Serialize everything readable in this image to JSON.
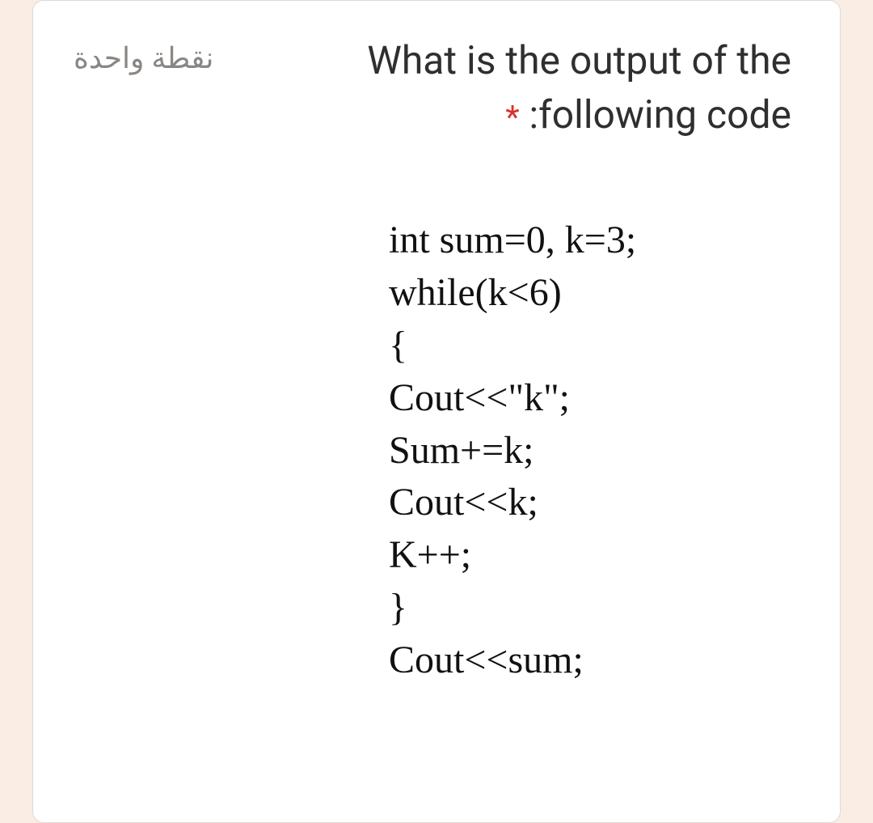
{
  "points_label": "نقطة واحدة",
  "question": {
    "line1": "What is the output of the",
    "asterisk": "*",
    "line2_prefix": " :following code"
  },
  "code": {
    "l1": "int sum=0, k=3;",
    "l2": "while(k<6)",
    "l3": "{",
    "l4": "Cout<<\"k\";",
    "l5": "Sum+=k;",
    "l6": "Cout<<k;",
    "l7": "K++;",
    "l8": "}",
    "l9": "Cout<<sum;"
  }
}
